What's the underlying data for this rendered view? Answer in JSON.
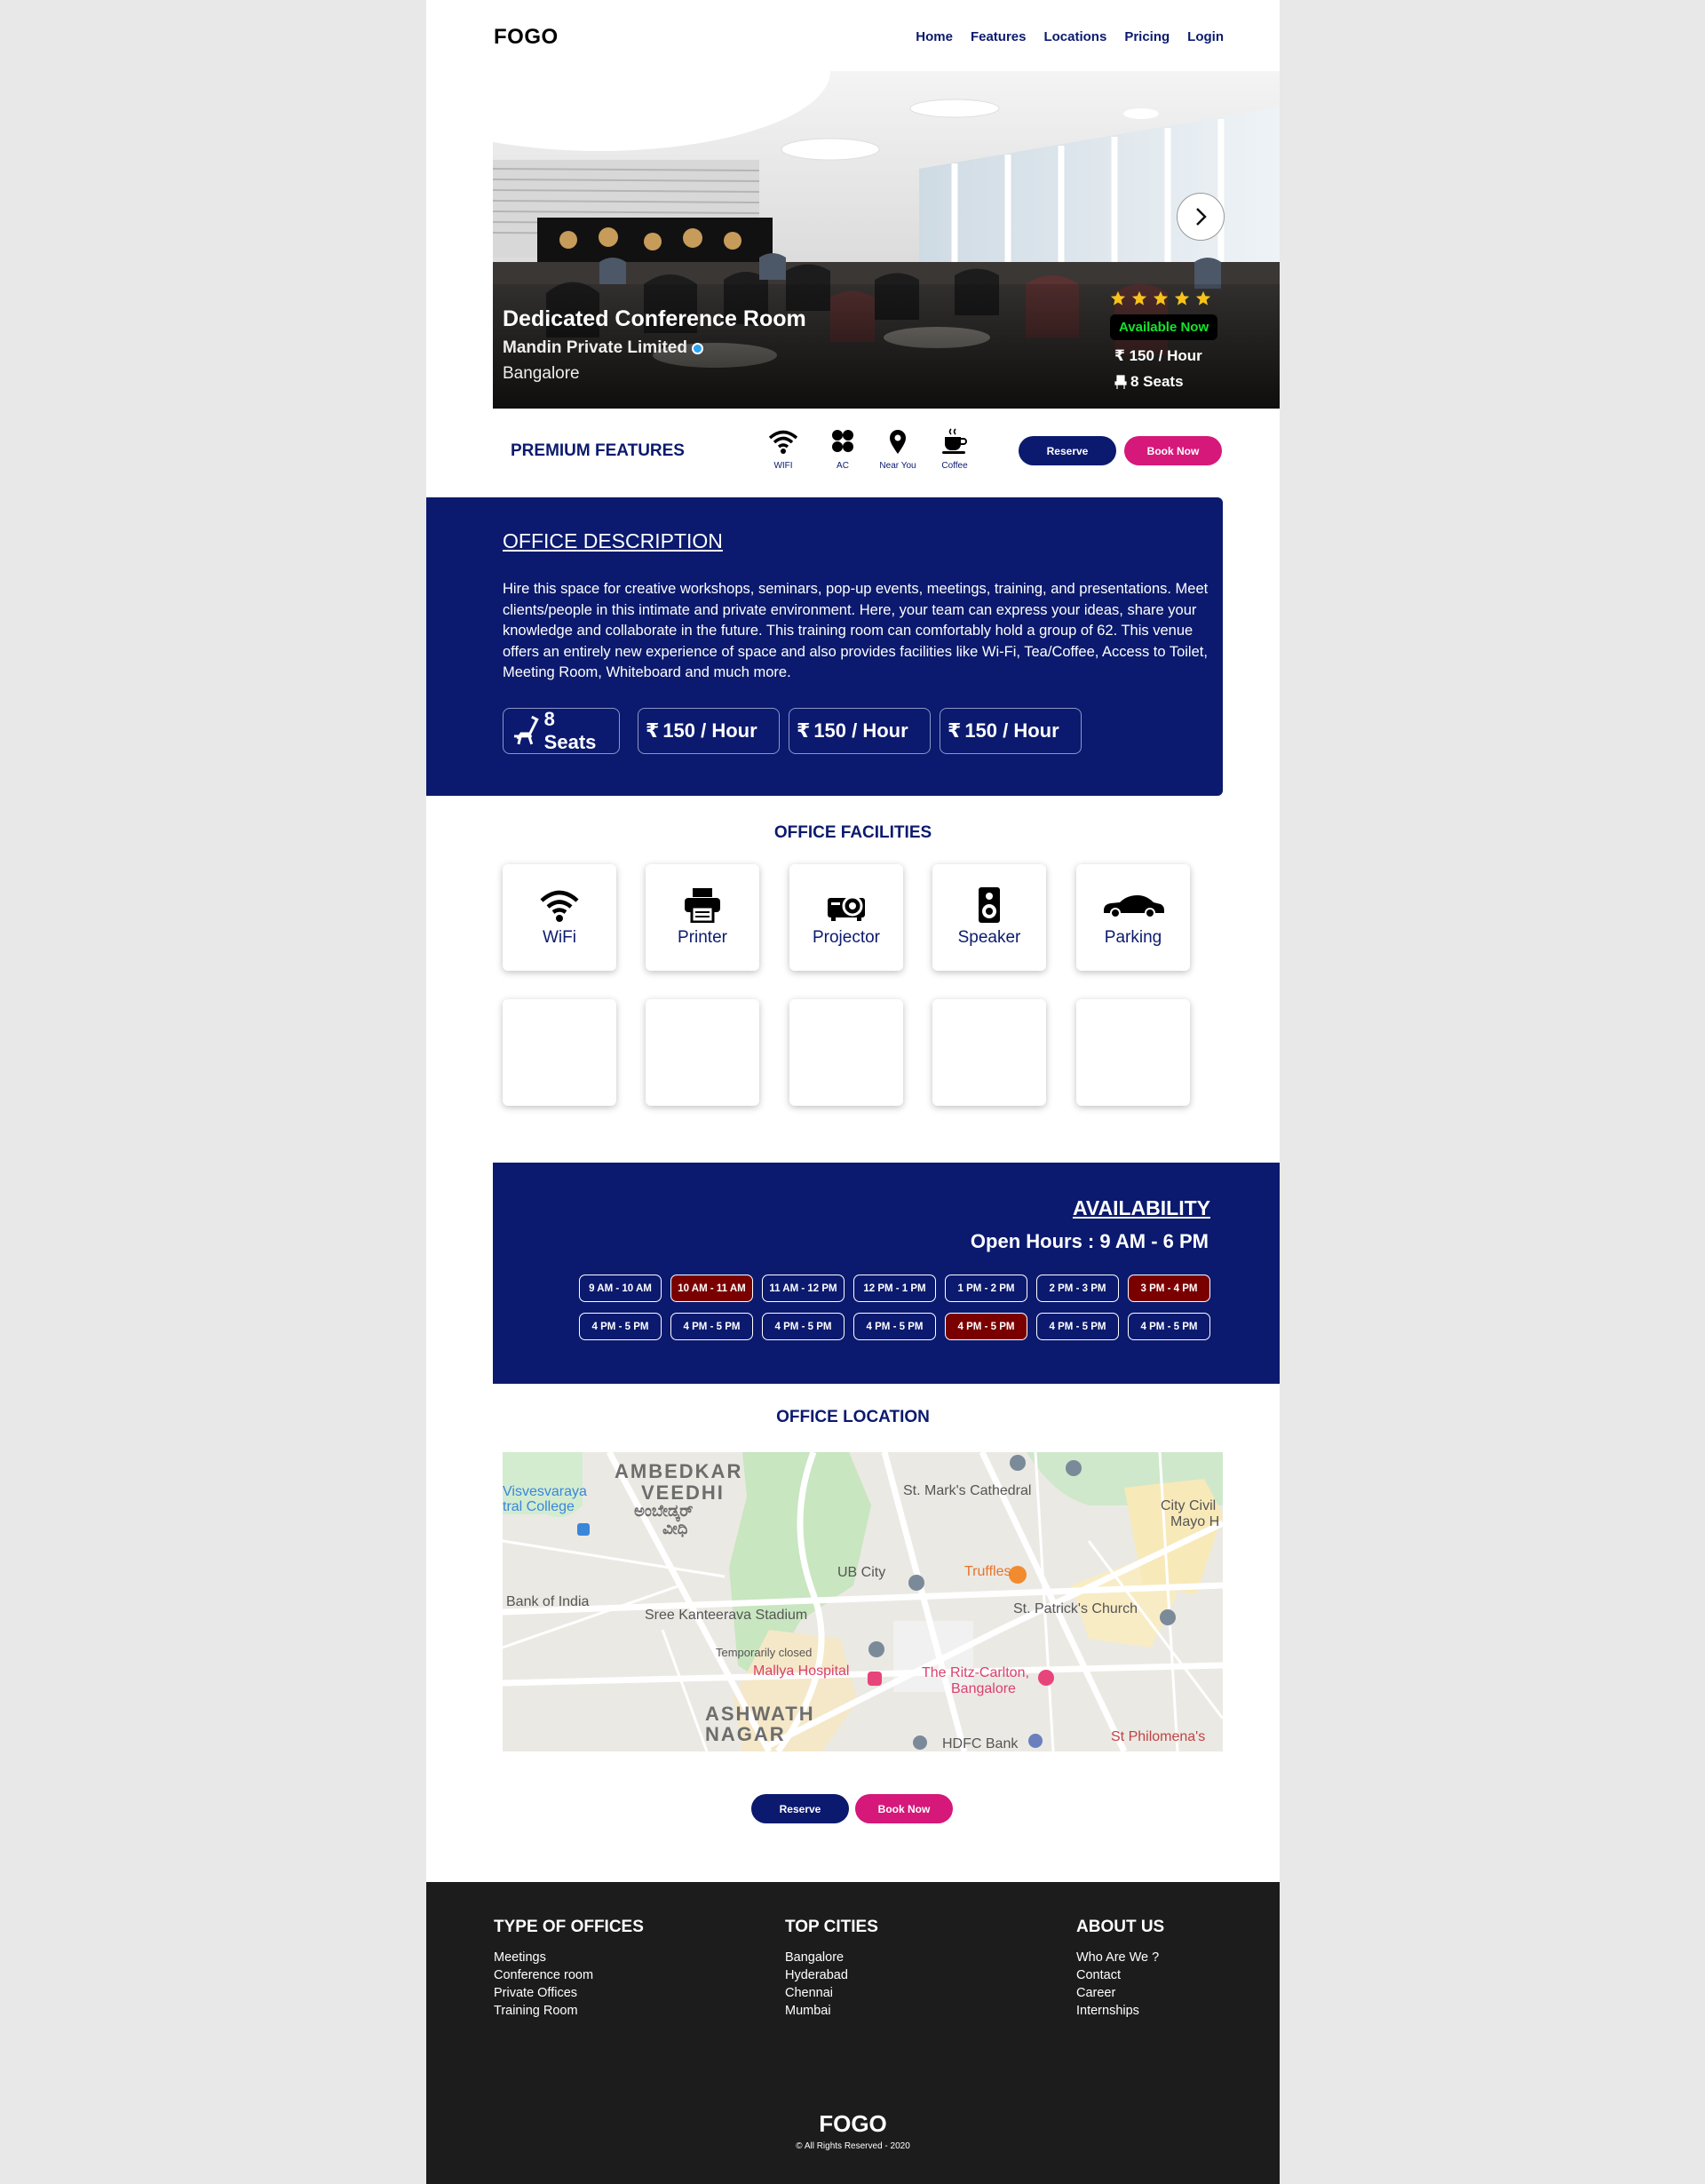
{
  "header": {
    "logo": "FOGO",
    "nav": [
      "Home",
      "Features",
      "Locations",
      "Pricing",
      "Login"
    ]
  },
  "hero": {
    "title": "Dedicated Conference Room",
    "company": "Mandin Private Limited",
    "city": "Bangalore",
    "rating": 5,
    "status": "Available Now",
    "price": "150 / Hour",
    "seats": "8 Seats"
  },
  "premium": {
    "label": "PREMIUM FEATURES",
    "features": [
      {
        "icon": "wifi-icon",
        "label": "WIFI"
      },
      {
        "icon": "fan-icon",
        "label": "AC"
      },
      {
        "icon": "location-pin-icon",
        "label": "Near You"
      },
      {
        "icon": "coffee-icon",
        "label": "Coffee"
      }
    ],
    "reserve": "Reserve",
    "book": "Book Now"
  },
  "description": {
    "title": "OFFICE DESCRIPTION",
    "text": "Hire this space for creative workshops, seminars, pop-up events, meetings, training, and presentations. Meet clients/people in this intimate and private environment. Here, your team can express your ideas, share your knowledge and collaborate in the future. This training room can comfortably hold a group of 62. This venue offers an entirely new experience of space and also provides facilities like Wi-Fi, Tea/Coffee, Access to Toilet, Meeting Room, Whiteboard and much more.",
    "chips": [
      "8 Seats",
      "150 / Hour",
      "150 / Hour",
      "150 / Hour"
    ]
  },
  "facilities": {
    "title": "OFFICE FACILITIES",
    "items": [
      {
        "icon": "wifi-icon",
        "label": "WiFi"
      },
      {
        "icon": "printer-icon",
        "label": "Printer"
      },
      {
        "icon": "projector-icon",
        "label": "Projector"
      },
      {
        "icon": "speaker-icon",
        "label": "Speaker"
      },
      {
        "icon": "car-icon",
        "label": "Parking"
      }
    ]
  },
  "availability": {
    "title": "AVAILABILITY",
    "hours": "Open Hours : 9 AM - 6 PM",
    "row1": [
      {
        "label": "9 AM - 10 AM",
        "booked": false
      },
      {
        "label": "10 AM - 11 AM",
        "booked": true
      },
      {
        "label": "11 AM - 12 PM",
        "booked": false
      },
      {
        "label": "12 PM - 1 PM",
        "booked": false
      },
      {
        "label": "1 PM - 2 PM",
        "booked": false
      },
      {
        "label": "2 PM - 3 PM",
        "booked": false
      },
      {
        "label": "3 PM - 4 PM",
        "booked": true
      }
    ],
    "row2": [
      {
        "label": "4 PM - 5 PM",
        "booked": false
      },
      {
        "label": "4 PM - 5 PM",
        "booked": false
      },
      {
        "label": "4 PM - 5 PM",
        "booked": false
      },
      {
        "label": "4 PM - 5 PM",
        "booked": false
      },
      {
        "label": "4 PM - 5 PM",
        "booked": true
      },
      {
        "label": "4 PM - 5 PM",
        "booked": false
      },
      {
        "label": "4 PM - 5 PM",
        "booked": false
      }
    ]
  },
  "location": {
    "title": "OFFICE LOCATION",
    "map_labels": [
      "AMBEDKAR",
      "VEEDHI",
      "ಅಂಬೇಡ್ಕರ್",
      "ವೀಧಿ",
      "St. Mark's Cathedral",
      "City Civil",
      "Mayo H",
      "Truffles",
      "St. Patrick's Church",
      "UB City",
      "Sree Kanteerava Stadium",
      "Temporarily closed",
      "Mallya Hospital",
      "The Ritz-Carlton,",
      "Bangalore",
      "ASHWATH",
      "NAGAR",
      "HDFC Bank",
      "St Philomena's",
      "Bank of India",
      "Visvesvaraya",
      "tral College"
    ],
    "reserve": "Reserve",
    "book": "Book Now"
  },
  "footer": {
    "columns": [
      {
        "title": "TYPE OF OFFICES",
        "links": [
          "Meetings",
          "Conference room",
          "Private Offices",
          "Training Room"
        ]
      },
      {
        "title": "TOP CITIES",
        "links": [
          "Bangalore",
          "Hyderabad",
          "Chennai",
          "Mumbai"
        ]
      },
      {
        "title": "ABOUT US",
        "links": [
          "Who Are We ?",
          "Contact",
          "Career",
          "Internships"
        ]
      }
    ],
    "logo": "FOGO",
    "copyright": "© All Rights Reserved - 2020"
  },
  "colors": {
    "navy": "#0b1a6e",
    "pink": "#d5187a",
    "booked": "#7a0000",
    "available_green": "#15e32b",
    "footer_bg": "#1c1c1c"
  }
}
